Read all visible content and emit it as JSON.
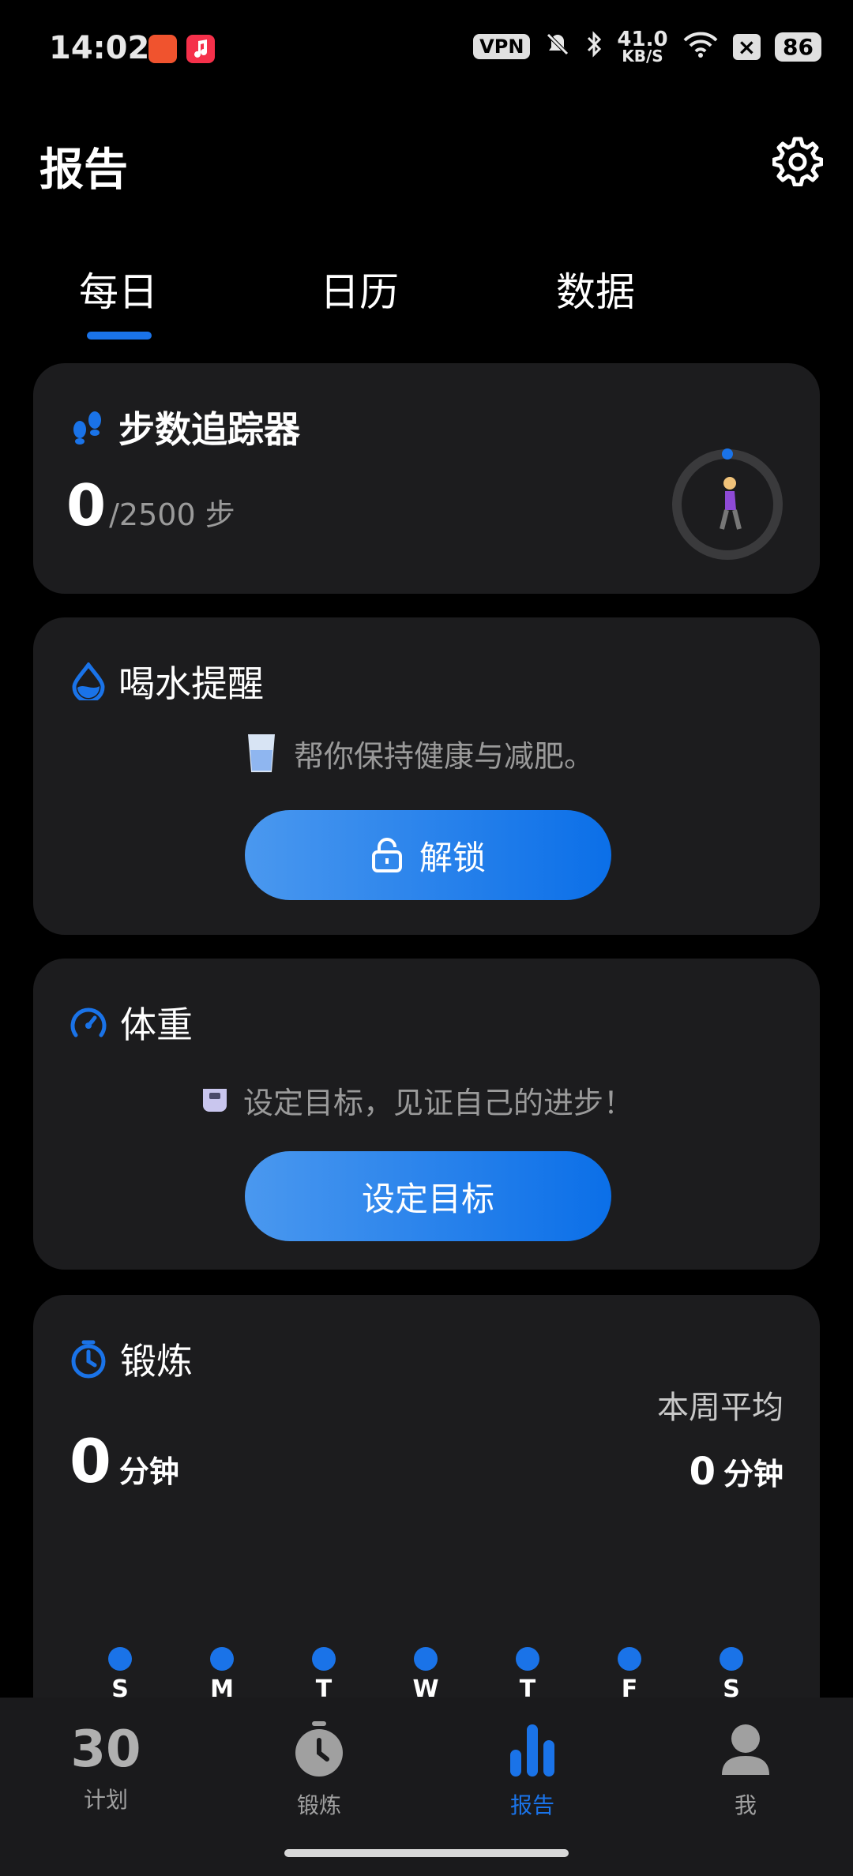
{
  "status": {
    "time": "14:02",
    "vpn": "VPN",
    "speed_value": "41.0",
    "speed_unit": "KB/S",
    "battery": "86"
  },
  "header": {
    "title": "报告"
  },
  "tabs": [
    {
      "label": "每日"
    },
    {
      "label": "日历"
    },
    {
      "label": "数据"
    }
  ],
  "steps": {
    "title": "步数追踪器",
    "current": "0",
    "goal": "/2500 步"
  },
  "water": {
    "title": "喝水提醒",
    "desc": "帮你保持健康与减肥。",
    "button": "解锁"
  },
  "weight": {
    "title": "体重",
    "desc": "设定目标，见证自己的进步！",
    "button": "设定目标"
  },
  "exercise": {
    "title": "锻炼",
    "value": "0",
    "unit": "分钟",
    "avg_label": "本周平均",
    "avg_value": "0",
    "avg_unit": "分钟",
    "days": [
      "S",
      "M",
      "T",
      "W",
      "T",
      "F",
      "S"
    ]
  },
  "bottom_nav": [
    {
      "label": "计划",
      "badge": "30"
    },
    {
      "label": "锻炼"
    },
    {
      "label": "报告"
    },
    {
      "label": "我"
    }
  ],
  "colors": {
    "accent": "#1a73e8",
    "card": "#1c1c1e",
    "background": "#000000"
  }
}
